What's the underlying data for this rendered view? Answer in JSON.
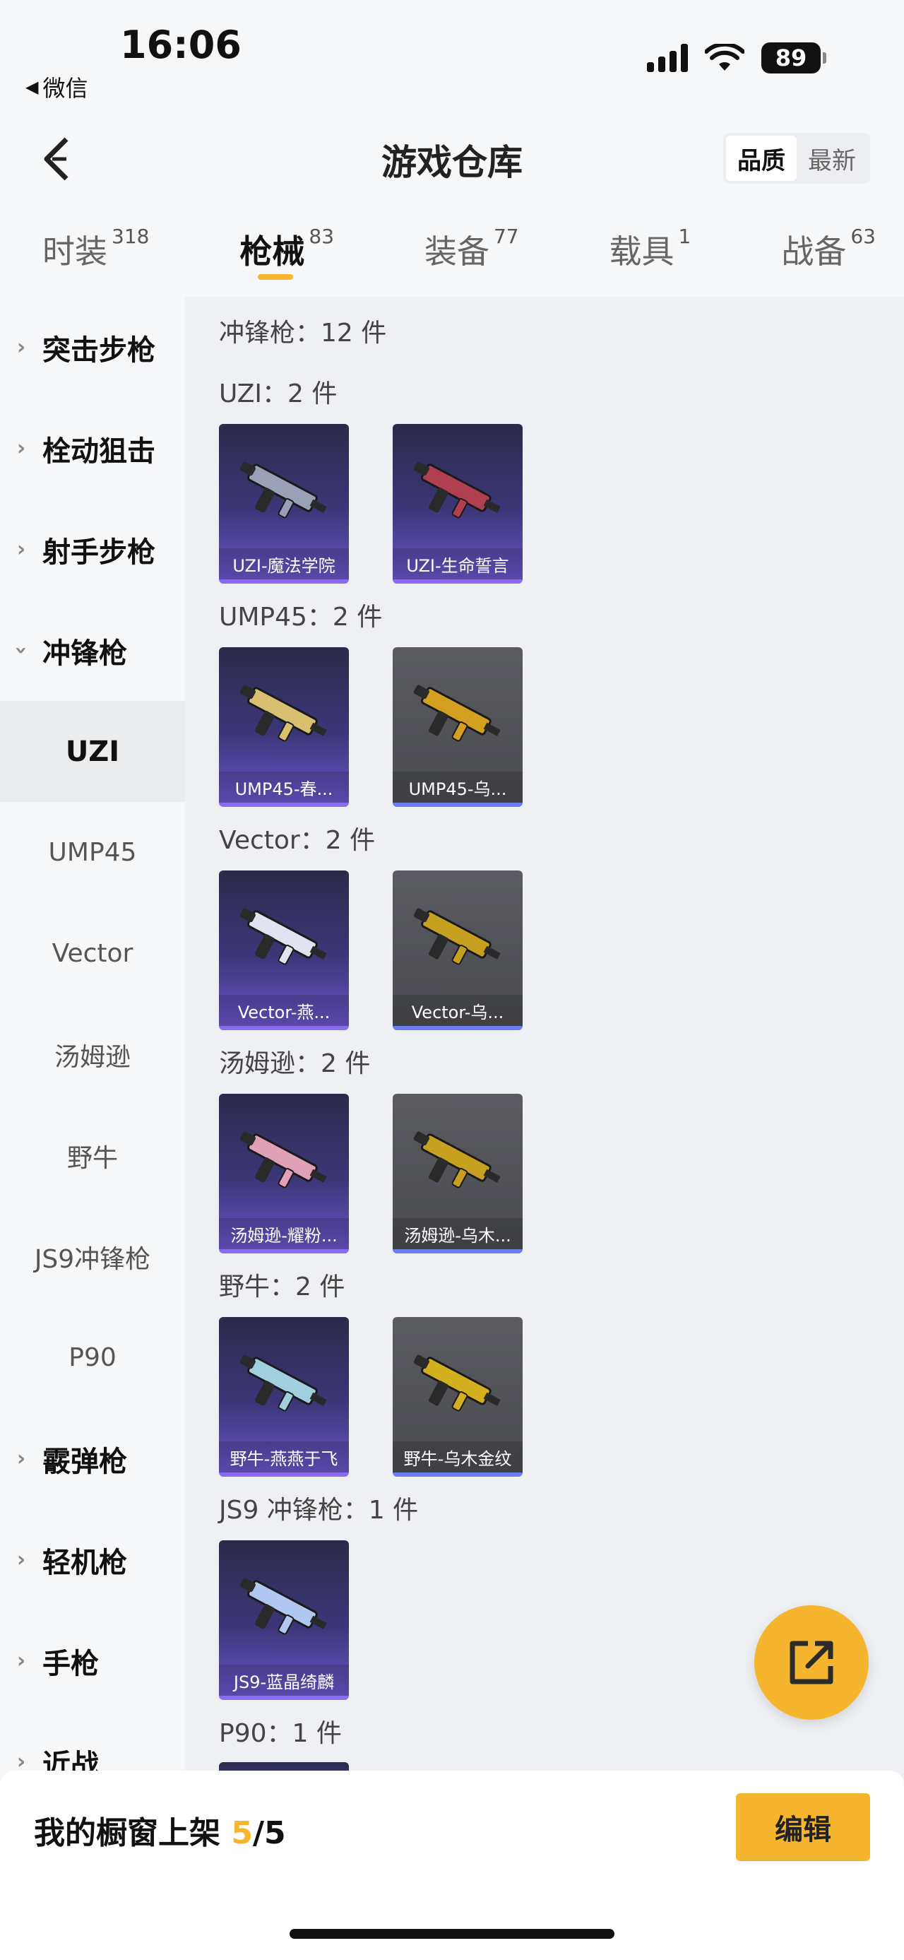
{
  "status": {
    "time": "16:06",
    "back_app": "微信",
    "battery": "89"
  },
  "header": {
    "title": "游戏仓库",
    "sort_options": [
      "品质",
      "最新"
    ],
    "active_sort": 0
  },
  "categories": [
    {
      "label": "时装",
      "count": "318"
    },
    {
      "label": "枪械",
      "count": "83",
      "active": true
    },
    {
      "label": "装备",
      "count": "77"
    },
    {
      "label": "载具",
      "count": "1"
    },
    {
      "label": "战备",
      "count": "63"
    }
  ],
  "sidebar": {
    "groups_before": [
      "突击步枪",
      "栓动狙击",
      "射手步枪"
    ],
    "expanded_group": "冲锋枪",
    "subitems": [
      "UZI",
      "UMP45",
      "Vector",
      "汤姆逊",
      "野牛",
      "JS9冲锋枪",
      "P90"
    ],
    "active_sub": "UZI",
    "groups_after": [
      "霰弹枪",
      "轻机枪",
      "手枪",
      "近战"
    ]
  },
  "content": {
    "total_title": "冲锋枪：12 件",
    "sections": [
      {
        "title": "UZI：2 件",
        "items": [
          {
            "name": "UZI-魔法学院",
            "rarity": "purple",
            "tint": "#9aa0b8"
          },
          {
            "name": "UZI-生命誓言",
            "rarity": "purple",
            "tint": "#b04050"
          }
        ]
      },
      {
        "title": "UMP45：2 件",
        "items": [
          {
            "name": "UMP45-春...",
            "rarity": "purple",
            "tint": "#d8c070"
          },
          {
            "name": "UMP45-乌...",
            "rarity": "gray",
            "tint": "#d4a020"
          }
        ]
      },
      {
        "title": "Vector：2 件",
        "items": [
          {
            "name": "Vector-燕...",
            "rarity": "purple",
            "tint": "#e0e4f0"
          },
          {
            "name": "Vector-乌...",
            "rarity": "gray",
            "tint": "#c8a020"
          }
        ]
      },
      {
        "title": "汤姆逊：2 件",
        "items": [
          {
            "name": "汤姆逊-耀粉...",
            "rarity": "purple",
            "tint": "#e0a0b8"
          },
          {
            "name": "汤姆逊-乌木...",
            "rarity": "gray",
            "tint": "#c8a020"
          }
        ]
      },
      {
        "title": "野牛：2 件",
        "items": [
          {
            "name": "野牛-燕燕于飞",
            "rarity": "purple",
            "tint": "#a0d0e0"
          },
          {
            "name": "野牛-乌木金纹",
            "rarity": "gray",
            "tint": "#d4b020"
          }
        ]
      },
      {
        "title": "JS9 冲锋枪：1 件",
        "items": [
          {
            "name": "JS9-蓝晶绮麟",
            "rarity": "purple",
            "tint": "#b0c8f0"
          }
        ]
      },
      {
        "title": "P90：1 件",
        "items": []
      }
    ]
  },
  "bottom": {
    "label_prefix": "我的橱窗上架 ",
    "current": "5",
    "separator": "/",
    "total": "5",
    "edit_label": "编辑"
  },
  "colors": {
    "accent": "#f5b52e",
    "purple_rarity": "#8a6cf0",
    "gray_rarity": "#6a7cf0"
  }
}
